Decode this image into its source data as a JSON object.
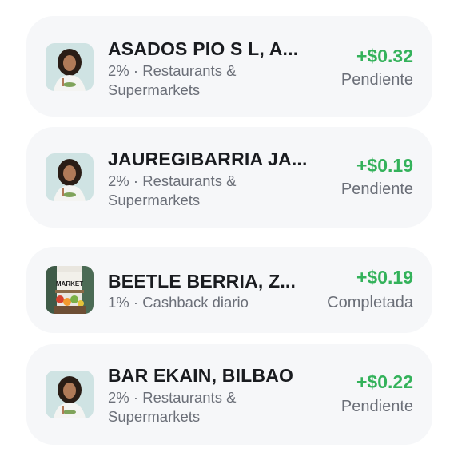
{
  "transactions": [
    {
      "merchant": "ASADOS PIO S L, A...",
      "rate": "2%",
      "category": "Restaurants & Supermarkets",
      "amount": "+$0.32",
      "status": "Pendiente",
      "icon": "woman-eating-icon"
    },
    {
      "merchant": "JAUREGIBARRIA JA...",
      "rate": "2%",
      "category": "Restaurants & Supermarkets",
      "amount": "+$0.19",
      "status": "Pendiente",
      "icon": "woman-eating-icon"
    },
    {
      "merchant": "BEETLE BERRIA, Z...",
      "rate": "1%",
      "category": "Cashback diario",
      "amount": "+$0.19",
      "status": "Completada",
      "icon": "market-icon",
      "icon_text": "MARKET"
    },
    {
      "merchant": "BAR EKAIN, BILBAO",
      "rate": "2%",
      "category": "Restaurants & Supermarkets",
      "amount": "+$0.22",
      "status": "Pendiente",
      "icon": "woman-eating-icon"
    }
  ],
  "separator": "·",
  "colors": {
    "amount": "#34b25b",
    "card_bg": "#f6f7f9",
    "muted": "#6b6f78"
  }
}
